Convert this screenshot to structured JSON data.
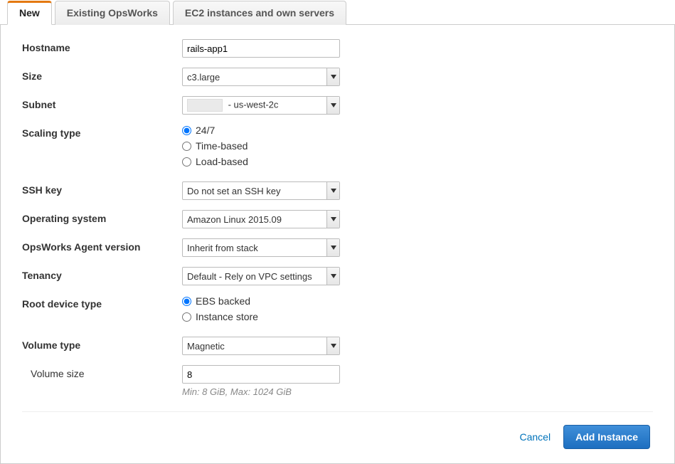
{
  "tabs": {
    "new": "New",
    "existing": "Existing OpsWorks",
    "ec2": "EC2 instances and own servers"
  },
  "labels": {
    "hostname": "Hostname",
    "size": "Size",
    "subnet": "Subnet",
    "scaling_type": "Scaling type",
    "ssh_key": "SSH key",
    "os": "Operating system",
    "agent": "OpsWorks Agent version",
    "tenancy": "Tenancy",
    "root_device": "Root device type",
    "volume_type": "Volume type",
    "volume_size": "Volume size"
  },
  "values": {
    "hostname": "rails-app1",
    "size": "c3.large",
    "subnet_suffix": " - us-west-2c",
    "ssh_key": "Do not set an SSH key",
    "os": "Amazon Linux 2015.09",
    "agent": "Inherit from stack",
    "tenancy": "Default - Rely on VPC settings",
    "volume_type": "Magnetic",
    "volume_size": "8",
    "volume_hint": "Min: 8 GiB, Max: 1024 GiB"
  },
  "scaling_options": {
    "always": "24/7",
    "time": "Time-based",
    "load": "Load-based"
  },
  "root_device_options": {
    "ebs": "EBS backed",
    "instance_store": "Instance store"
  },
  "buttons": {
    "cancel": "Cancel",
    "add": "Add Instance"
  }
}
